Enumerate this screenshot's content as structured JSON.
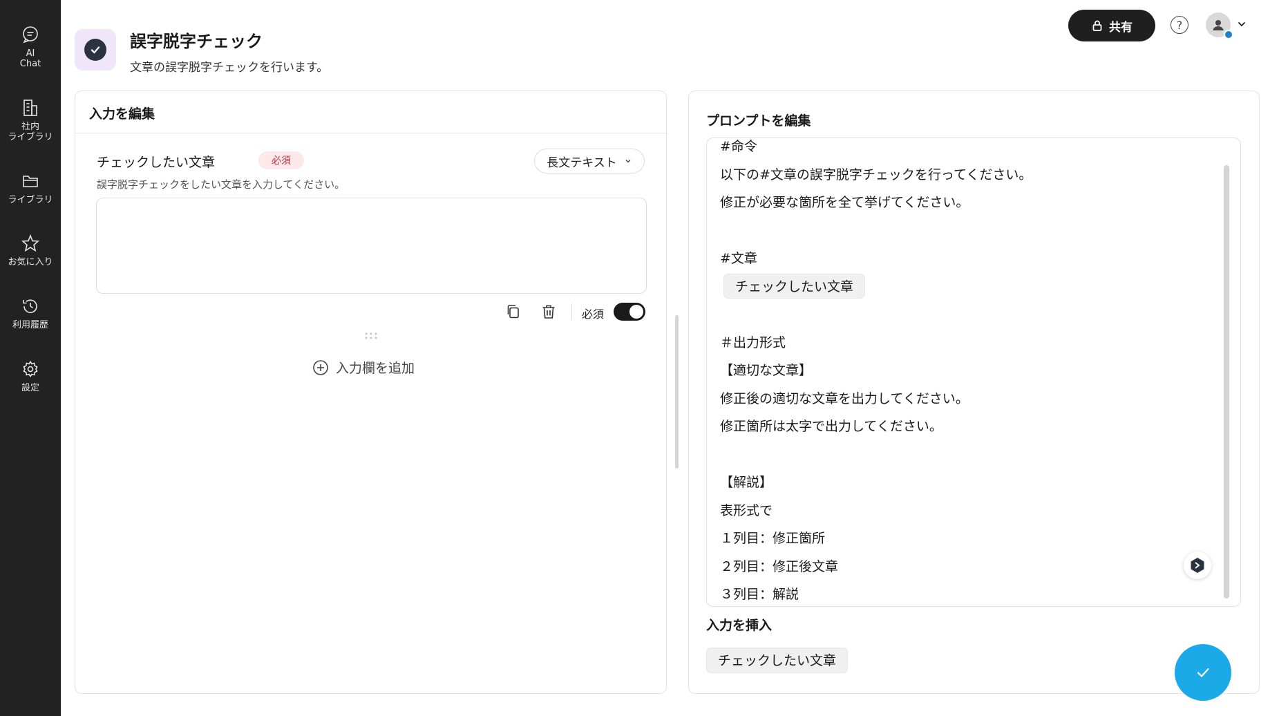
{
  "sidebar": {
    "items": [
      {
        "label": "AI\nChat",
        "icon": "chat-icon"
      },
      {
        "label": "社内\nライブラリ",
        "icon": "building-icon"
      },
      {
        "label": "ライブラリ",
        "icon": "folder-icon"
      },
      {
        "label": "お気に入り",
        "icon": "star-icon"
      },
      {
        "label": "利用履歴",
        "icon": "history-icon"
      },
      {
        "label": "設定",
        "icon": "gear-icon"
      }
    ]
  },
  "header": {
    "title": "誤字脱字チェック",
    "description": "文章の誤字脱字チェックを行います。",
    "share_label": "共有",
    "help_glyph": "?"
  },
  "input_editor": {
    "title": "入力を編集",
    "field": {
      "label": "チェックしたい文章",
      "required_badge": "必須",
      "type": "長文テキスト",
      "description": "誤字脱字チェックをしたい文章を入力してください。",
      "value": ""
    },
    "required_toggle_label": "必須",
    "required_on": true,
    "add_field_label": "入力欄を追加"
  },
  "prompt_editor": {
    "title": "プロンプトを編集",
    "lines": [
      {
        "text": "#命令"
      },
      {
        "text": "以下の#文章の誤字脱字チェックを行ってください。"
      },
      {
        "text": "修正が必要な箇所を全て挙げてください。"
      },
      {
        "text": ""
      },
      {
        "text": "#文章"
      },
      {
        "chip": "チェックしたい文章"
      },
      {
        "text": ""
      },
      {
        "text": "＃出力形式"
      },
      {
        "text": "【適切な文章】"
      },
      {
        "text": "修正後の適切な文章を出力してください。"
      },
      {
        "text": "修正箇所は太字で出力してください。"
      },
      {
        "text": ""
      },
      {
        "text": "【解説】"
      },
      {
        "text": "表形式で"
      },
      {
        "text": "１列目：修正箇所"
      },
      {
        "text": "２列目：修正後文章"
      },
      {
        "text": "３列目：解説"
      }
    ],
    "insert_title": "入力を挿入",
    "insert_chip": "チェックしたい文章"
  },
  "colors": {
    "sidebar_bg": "#222222",
    "accent": "#1ba9e8",
    "required_badge_bg": "#fde8ea",
    "required_badge_text": "#c0364a"
  }
}
